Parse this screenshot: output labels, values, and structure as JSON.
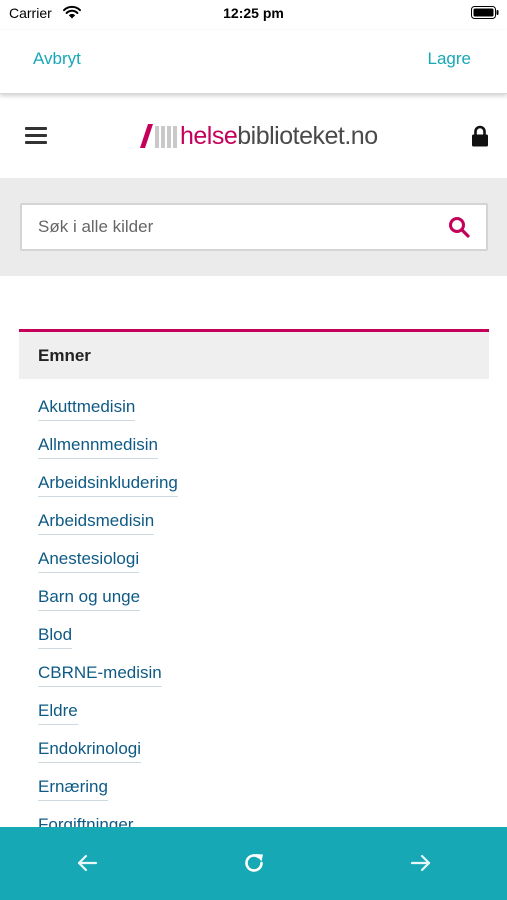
{
  "status_bar": {
    "carrier": "Carrier",
    "time": "12:25 pm"
  },
  "nav": {
    "cancel_label": "Avbryt",
    "save_label": "Lagre"
  },
  "site": {
    "logo_highlight": "helse",
    "logo_rest": "biblioteket.no",
    "search_placeholder": "Søk i alle kilder"
  },
  "topics": {
    "title": "Emner",
    "items": [
      "Akuttmedisin",
      "Allmennmedisin",
      "Arbeidsinkludering",
      "Arbeidsmedisin",
      "Anestesiologi",
      "Barn og unge",
      "Blod",
      "CBRNE-medisin",
      "Eldre",
      "Endokrinologi",
      "Ernæring",
      "Forgiftninger"
    ]
  },
  "icons": {
    "menu": "hamburger-icon",
    "lock": "lock-icon",
    "search": "search-icon",
    "back": "arrow-left-icon",
    "reload": "reload-icon",
    "forward": "arrow-right-icon"
  },
  "colors": {
    "accent": "#17a8b5",
    "brand": "#c4005a",
    "link": "#0e5a85"
  }
}
